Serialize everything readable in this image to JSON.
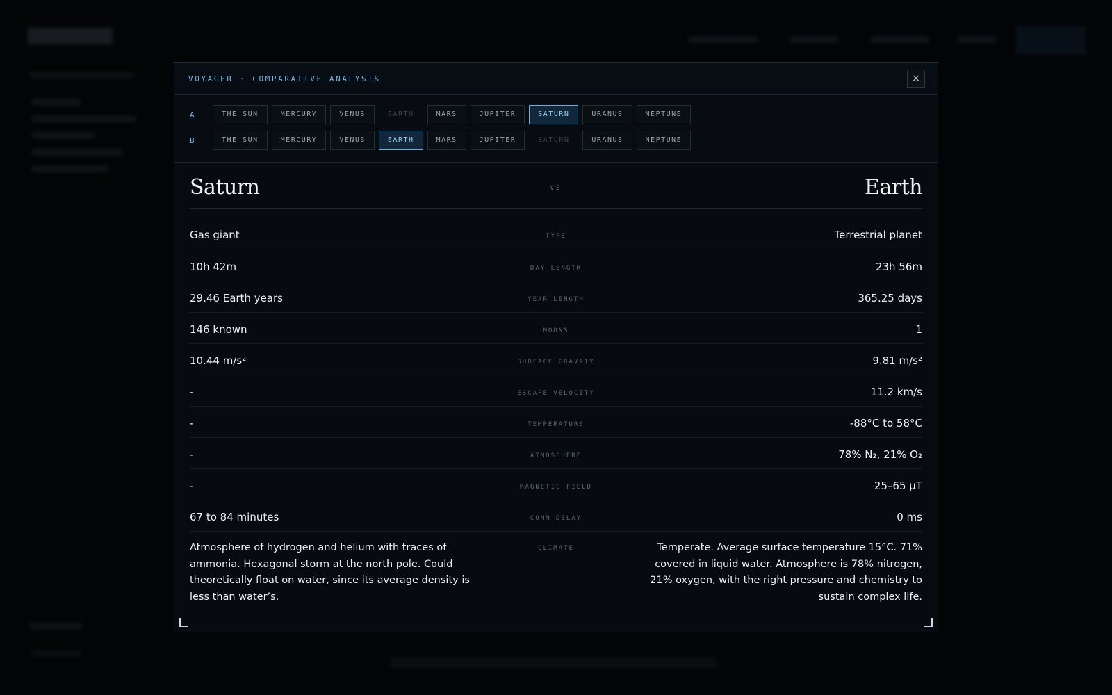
{
  "modal": {
    "title": "VOYAGER · COMPARATIVE ANALYSIS",
    "close_label": "×"
  },
  "selectors": {
    "a": {
      "letter": "A",
      "items": [
        {
          "label": "THE SUN",
          "state": "normal"
        },
        {
          "label": "MERCURY",
          "state": "normal"
        },
        {
          "label": "VENUS",
          "state": "normal"
        },
        {
          "label": "EARTH",
          "state": "disabled"
        },
        {
          "label": "MARS",
          "state": "normal"
        },
        {
          "label": "JUPITER",
          "state": "normal"
        },
        {
          "label": "SATURN",
          "state": "active"
        },
        {
          "label": "URANUS",
          "state": "normal"
        },
        {
          "label": "NEPTUNE",
          "state": "normal"
        }
      ]
    },
    "b": {
      "letter": "B",
      "items": [
        {
          "label": "THE SUN",
          "state": "normal"
        },
        {
          "label": "MERCURY",
          "state": "normal"
        },
        {
          "label": "VENUS",
          "state": "normal"
        },
        {
          "label": "EARTH",
          "state": "active"
        },
        {
          "label": "MARS",
          "state": "normal"
        },
        {
          "label": "JUPITER",
          "state": "normal"
        },
        {
          "label": "SATURN",
          "state": "disabled"
        },
        {
          "label": "URANUS",
          "state": "normal"
        },
        {
          "label": "NEPTUNE",
          "state": "normal"
        }
      ]
    }
  },
  "comparison": {
    "name_a": "Saturn",
    "name_b": "Earth",
    "vs": "VS",
    "rows": [
      {
        "label": "TYPE",
        "a": "Gas giant",
        "b": "Terrestrial planet"
      },
      {
        "label": "DAY LENGTH",
        "a": "10h 42m",
        "b": "23h 56m"
      },
      {
        "label": "YEAR LENGTH",
        "a": "29.46 Earth years",
        "b": "365.25 days"
      },
      {
        "label": "MOONS",
        "a": "146 known",
        "b": "1"
      },
      {
        "label": "SURFACE GRAVITY",
        "a": "10.44 m/s²",
        "b": "9.81 m/s²"
      },
      {
        "label": "ESCAPE VELOCITY",
        "a": "-",
        "b": "11.2 km/s"
      },
      {
        "label": "TEMPERATURE",
        "a": "-",
        "b": "-88°C to 58°C"
      },
      {
        "label": "ATMOSPHERE",
        "a": "-",
        "b": "78% N₂, 21% O₂"
      },
      {
        "label": "MAGNETIC FIELD",
        "a": "-",
        "b": "25–65 µT"
      },
      {
        "label": "COMM DELAY",
        "a": "67 to 84 minutes",
        "b": "0 ms"
      },
      {
        "label": "CLIMATE",
        "a": "Atmosphere of hydrogen and helium with traces of ammonia. Hexagonal storm at the north pole. Could theoretically float on water, since its average density is less than water’s.",
        "b": "Temperate. Average surface temperature 15°C. 71% covered in liquid water. Atmosphere is 78% nitrogen, 21% oxygen, with the right pressure and chemistry to sustain complex life."
      }
    ]
  },
  "colors": {
    "accent": "#6fb8e3",
    "active_border": "#5cb4e6",
    "background": "#030406",
    "modal_background": "#070b10"
  }
}
